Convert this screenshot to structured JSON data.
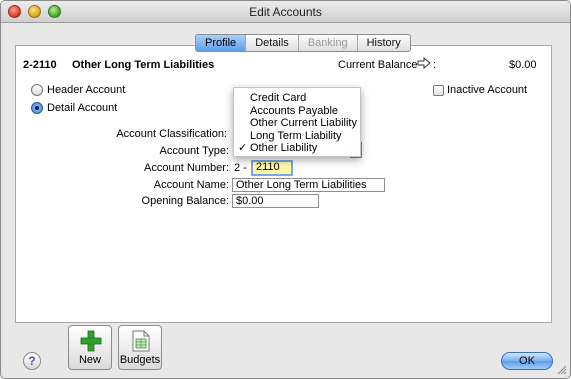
{
  "window": {
    "title": "Edit Accounts"
  },
  "tabs": [
    {
      "label": "Profile",
      "state": "active"
    },
    {
      "label": "Details",
      "state": "normal"
    },
    {
      "label": "Banking",
      "state": "disabled"
    },
    {
      "label": "History",
      "state": "normal"
    }
  ],
  "account_header": {
    "code": "2-2110",
    "name": "Other Long Term Liabilities",
    "balance_label": "Current Balance",
    "balance_value": "$0.00"
  },
  "account_kind": {
    "options": [
      "Header Account",
      "Detail Account"
    ],
    "selected": "Detail Account"
  },
  "inactive": {
    "label": "Inactive Account",
    "checked": false
  },
  "form": {
    "classification_label": "Account Classification:",
    "type_label": "Account Type:",
    "number_label": "Account Number:",
    "number_prefix": "2 -",
    "number_value": "2110",
    "name_label": "Account Name:",
    "name_value": "Other Long Term Liabilities",
    "opening_label": "Opening Balance:",
    "opening_value": "$0.00"
  },
  "type_menu": {
    "items": [
      "Credit Card",
      "Accounts Payable",
      "Other Current Liability",
      "Long Term Liability",
      "Other Liability"
    ],
    "checked": "Other Liability",
    "check_glyph": "✓"
  },
  "footer": {
    "help_label": "?",
    "new_label": "New",
    "budgets_label": "Budgets",
    "ok_label": "OK"
  },
  "colors": {
    "accent": "#5d9eea",
    "focus_field": "#fff8a8",
    "plus_icon": "#2fa12f"
  },
  "icons": {
    "balance_arrow": "arrow-right-icon",
    "new": "plus-icon",
    "budgets": "spreadsheet-icon"
  }
}
